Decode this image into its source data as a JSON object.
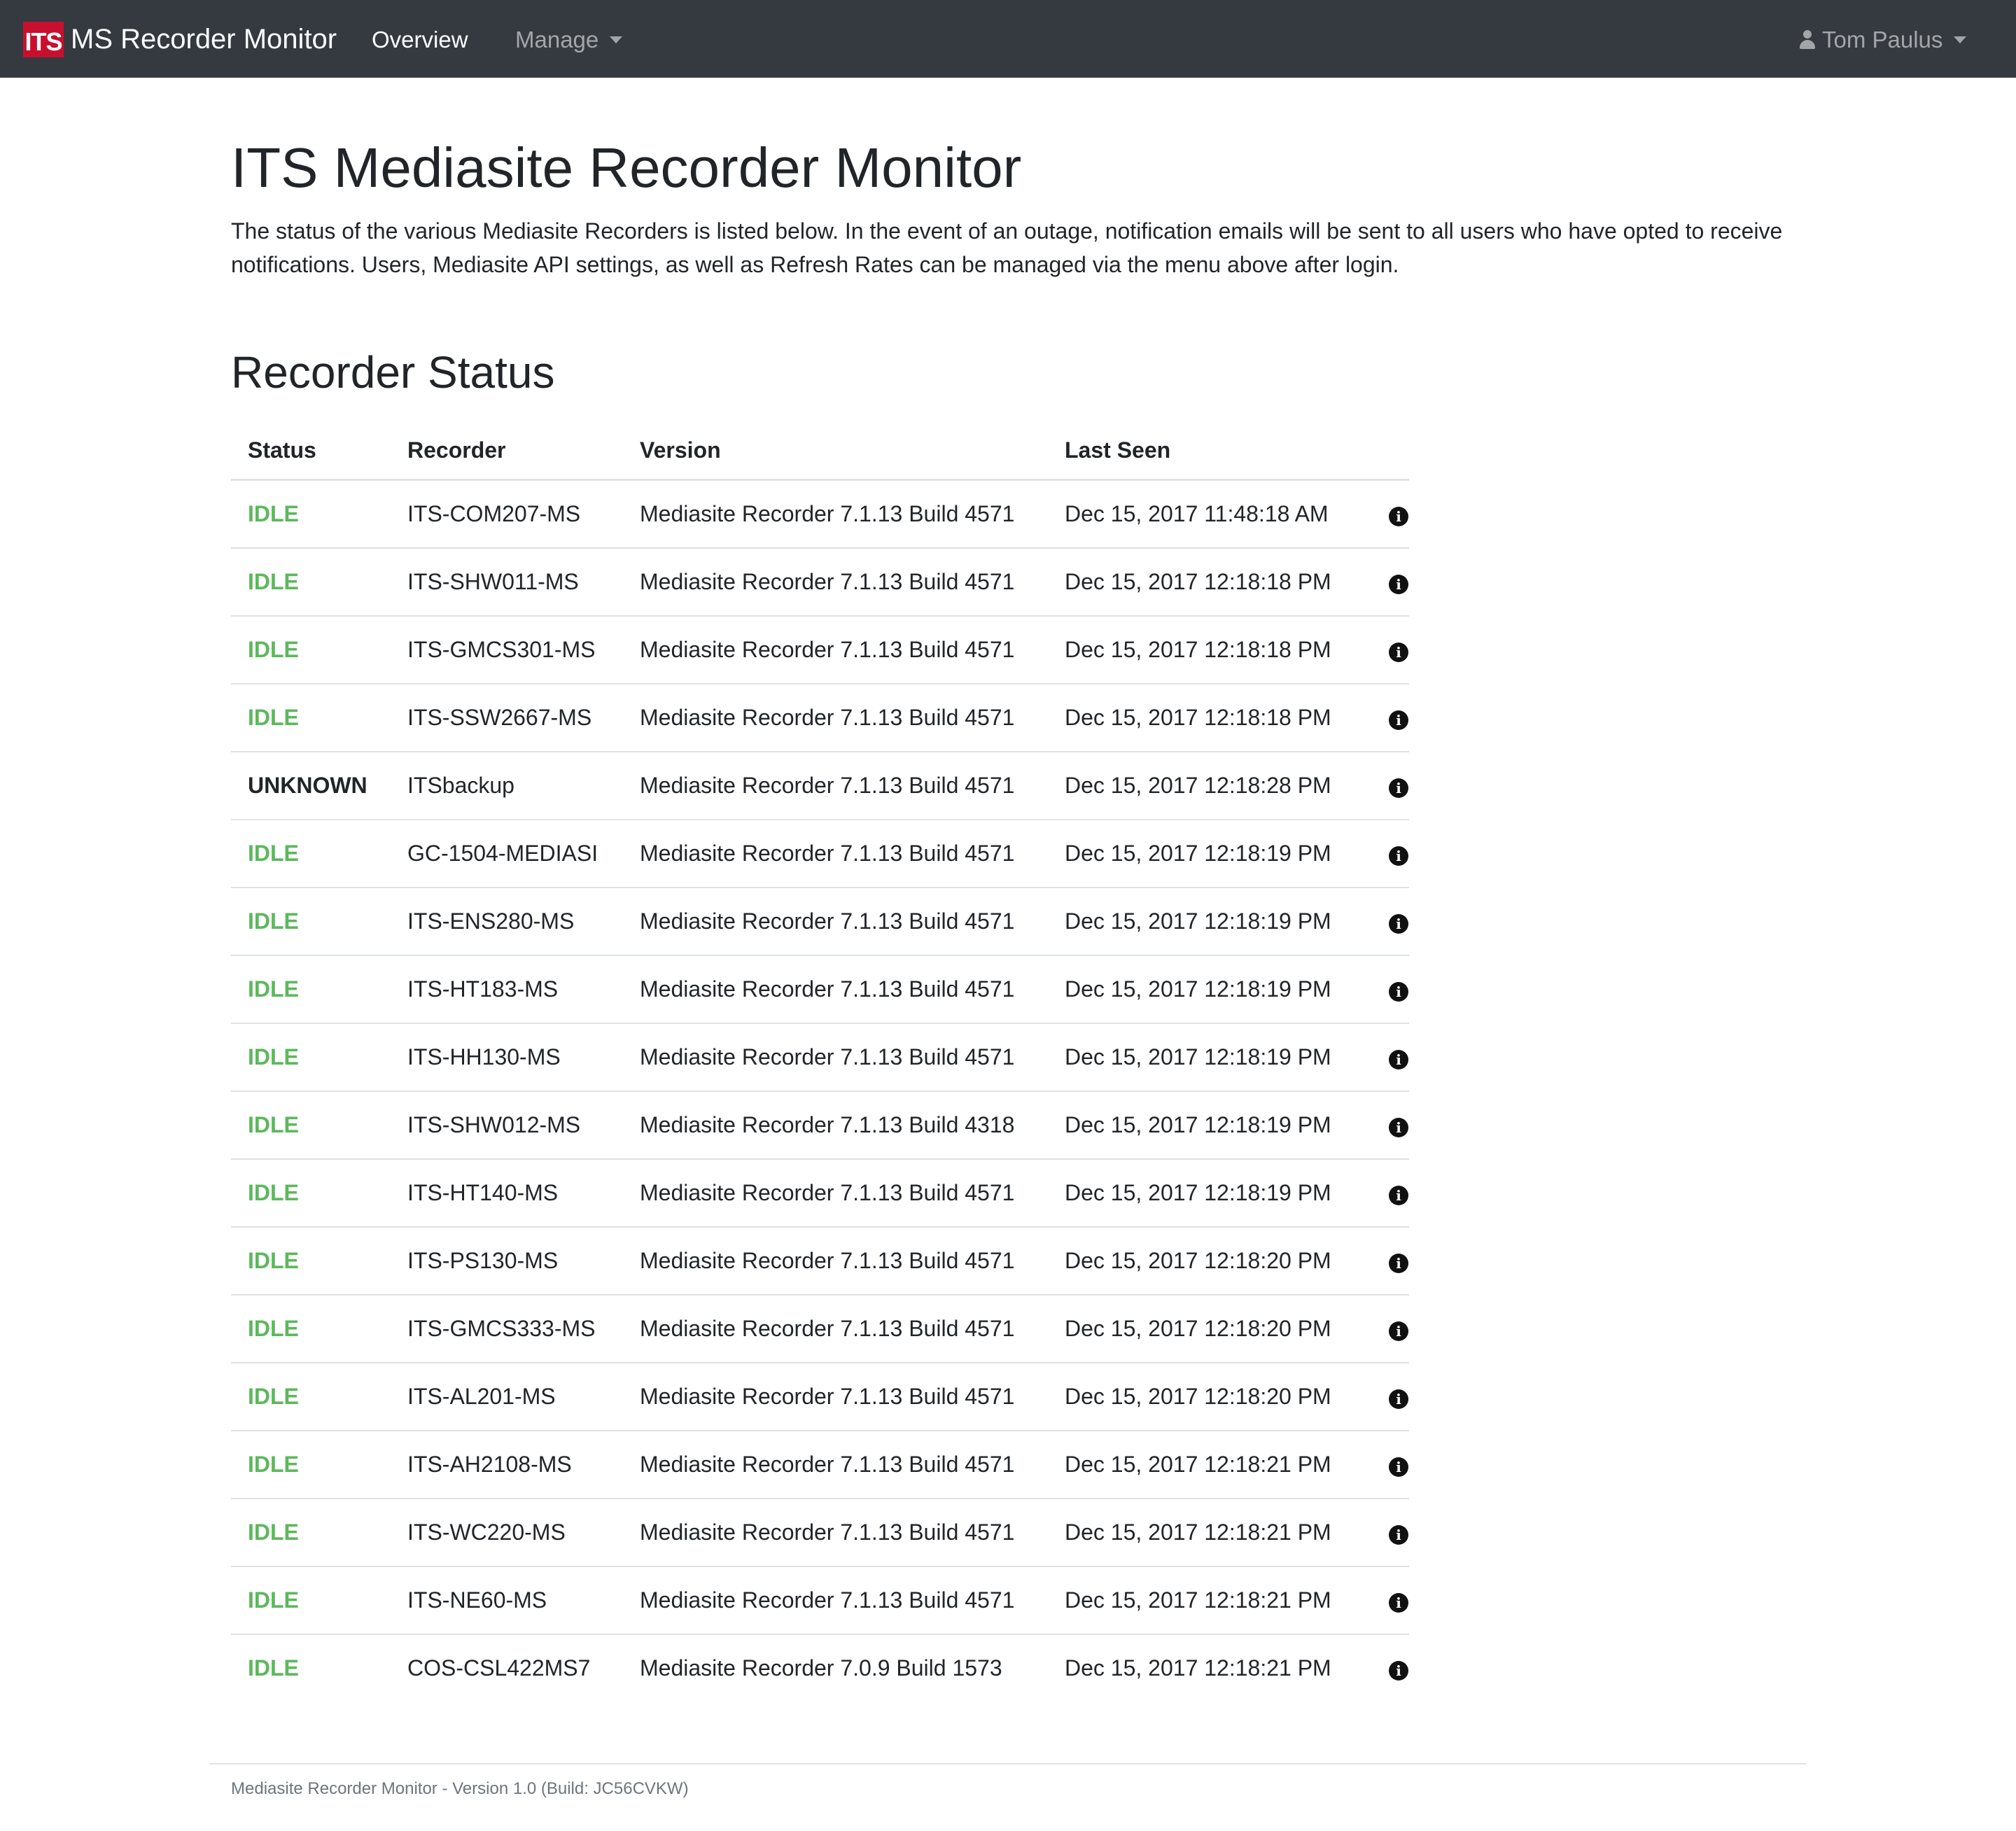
{
  "navbar": {
    "logo_text": "ITS",
    "brand": "MS Recorder Monitor",
    "overview": "Overview",
    "manage": "Manage",
    "user": "Tom Paulus"
  },
  "header": {
    "title": "ITS Mediasite Recorder Monitor",
    "description": "The status of the various Mediasite Recorders is listed below. In the event of an outage, notification emails will be sent to all users who have opted to receive notifications. Users, Mediasite API settings, as well as Refresh Rates can be managed via the menu above after login."
  },
  "recorder_status": {
    "title": "Recorder Status",
    "columns": [
      "Status",
      "Recorder",
      "Version",
      "Last Seen"
    ],
    "rows": [
      {
        "status": "IDLE",
        "recorder": "ITS-COM207-MS",
        "version": "Mediasite Recorder 7.1.13 Build 4571",
        "last_seen": "Dec 15, 2017 11:48:18 AM"
      },
      {
        "status": "IDLE",
        "recorder": "ITS-SHW011-MS",
        "version": "Mediasite Recorder 7.1.13 Build 4571",
        "last_seen": "Dec 15, 2017 12:18:18 PM"
      },
      {
        "status": "IDLE",
        "recorder": "ITS-GMCS301-MS",
        "version": "Mediasite Recorder 7.1.13 Build 4571",
        "last_seen": "Dec 15, 2017 12:18:18 PM"
      },
      {
        "status": "IDLE",
        "recorder": "ITS-SSW2667-MS",
        "version": "Mediasite Recorder 7.1.13 Build 4571",
        "last_seen": "Dec 15, 2017 12:18:18 PM"
      },
      {
        "status": "UNKNOWN",
        "recorder": "ITSbackup",
        "version": "Mediasite Recorder 7.1.13 Build 4571",
        "last_seen": "Dec 15, 2017 12:18:28 PM"
      },
      {
        "status": "IDLE",
        "recorder": "GC-1504-MEDIASI",
        "version": "Mediasite Recorder 7.1.13 Build 4571",
        "last_seen": "Dec 15, 2017 12:18:19 PM"
      },
      {
        "status": "IDLE",
        "recorder": "ITS-ENS280-MS",
        "version": "Mediasite Recorder 7.1.13 Build 4571",
        "last_seen": "Dec 15, 2017 12:18:19 PM"
      },
      {
        "status": "IDLE",
        "recorder": "ITS-HT183-MS",
        "version": "Mediasite Recorder 7.1.13 Build 4571",
        "last_seen": "Dec 15, 2017 12:18:19 PM"
      },
      {
        "status": "IDLE",
        "recorder": "ITS-HH130-MS",
        "version": "Mediasite Recorder 7.1.13 Build 4571",
        "last_seen": "Dec 15, 2017 12:18:19 PM"
      },
      {
        "status": "IDLE",
        "recorder": "ITS-SHW012-MS",
        "version": "Mediasite Recorder 7.1.13 Build 4318",
        "last_seen": "Dec 15, 2017 12:18:19 PM"
      },
      {
        "status": "IDLE",
        "recorder": "ITS-HT140-MS",
        "version": "Mediasite Recorder 7.1.13 Build 4571",
        "last_seen": "Dec 15, 2017 12:18:19 PM"
      },
      {
        "status": "IDLE",
        "recorder": "ITS-PS130-MS",
        "version": "Mediasite Recorder 7.1.13 Build 4571",
        "last_seen": "Dec 15, 2017 12:18:20 PM"
      },
      {
        "status": "IDLE",
        "recorder": "ITS-GMCS333-MS",
        "version": "Mediasite Recorder 7.1.13 Build 4571",
        "last_seen": "Dec 15, 2017 12:18:20 PM"
      },
      {
        "status": "IDLE",
        "recorder": "ITS-AL201-MS",
        "version": "Mediasite Recorder 7.1.13 Build 4571",
        "last_seen": "Dec 15, 2017 12:18:20 PM"
      },
      {
        "status": "IDLE",
        "recorder": "ITS-AH2108-MS",
        "version": "Mediasite Recorder 7.1.13 Build 4571",
        "last_seen": "Dec 15, 2017 12:18:21 PM"
      },
      {
        "status": "IDLE",
        "recorder": "ITS-WC220-MS",
        "version": "Mediasite Recorder 7.1.13 Build 4571",
        "last_seen": "Dec 15, 2017 12:18:21 PM"
      },
      {
        "status": "IDLE",
        "recorder": "ITS-NE60-MS",
        "version": "Mediasite Recorder 7.1.13 Build 4571",
        "last_seen": "Dec 15, 2017 12:18:21 PM"
      },
      {
        "status": "IDLE",
        "recorder": "COS-CSL422MS7",
        "version": "Mediasite Recorder 7.0.9 Build 1573",
        "last_seen": "Dec 15, 2017 12:18:21 PM"
      }
    ],
    "info_icon": "info-circle-icon"
  },
  "colors": {
    "navbar_bg": "#343a40",
    "logo_red": "#c8102e",
    "status_idle": "#5cb85c",
    "status_unknown": "#212529"
  },
  "footer": {
    "text": "Mediasite Recorder Monitor - Version 1.0 (Build: JC56CVKW)"
  }
}
